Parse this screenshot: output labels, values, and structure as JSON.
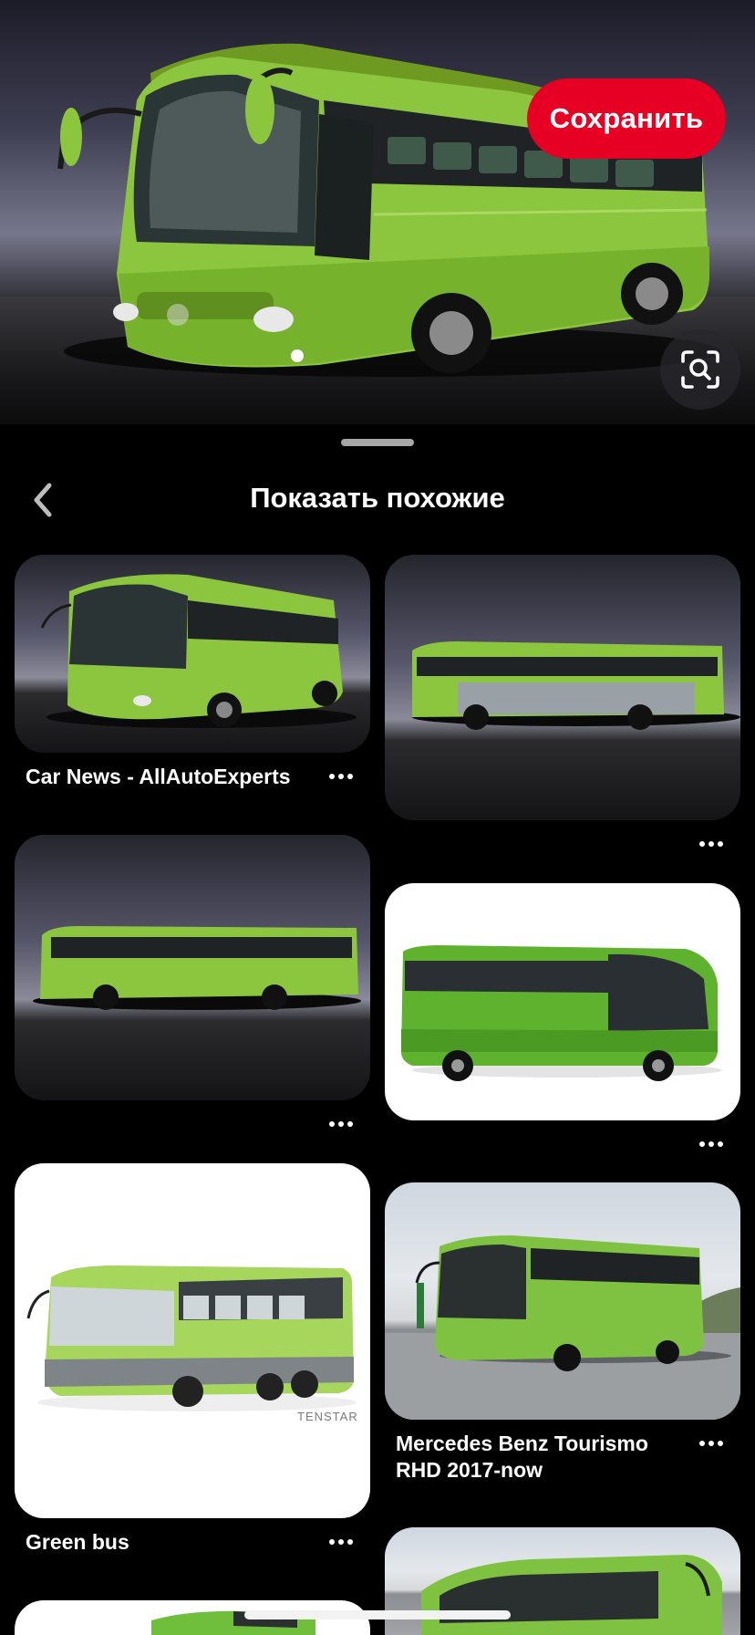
{
  "hero": {
    "save_label": "Сохранить",
    "lens_icon": "visual-search-icon"
  },
  "sheet": {
    "title": "Показать похожие",
    "back_icon": "chevron-left-icon"
  },
  "pins": [
    {
      "caption": "Car News - AllAutoExperts"
    },
    {
      "caption": ""
    },
    {
      "caption": ""
    },
    {
      "caption": ""
    },
    {
      "caption": "Green bus"
    },
    {
      "caption": "Mercedes Benz Tourismo RHD 2017-now"
    },
    {
      "caption": ""
    },
    {
      "caption": ""
    }
  ],
  "pin_image_text": {
    "tenstar": "TENSTAR"
  },
  "colors": {
    "accent": "#e60023",
    "bus_green": "#8cc63f",
    "background": "#000000"
  }
}
